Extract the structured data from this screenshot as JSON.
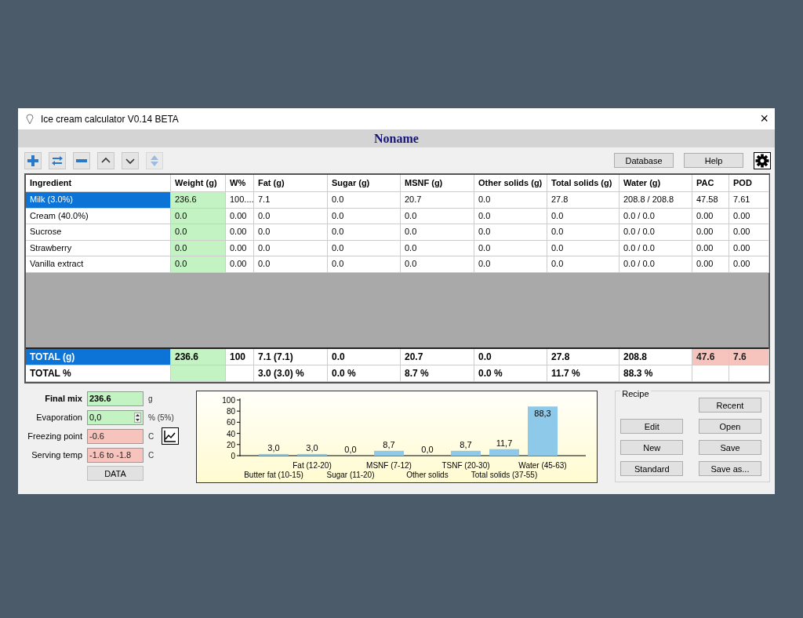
{
  "window": {
    "title": "Ice cream calculator  V0.14 BETA",
    "close": "×"
  },
  "recipe_name": "Noname",
  "toolbar": {
    "tools": [
      {
        "kind": "plus",
        "disabled": false
      },
      {
        "kind": "swap",
        "disabled": false
      },
      {
        "kind": "minus",
        "disabled": false
      },
      {
        "kind": "up",
        "disabled": false
      },
      {
        "kind": "down",
        "disabled": false
      },
      {
        "kind": "updown",
        "disabled": true
      }
    ],
    "buttons": [
      "Database",
      "Help"
    ]
  },
  "table": {
    "columns": [
      "Ingredient",
      "Weight (g)",
      "W%",
      "Fat (g)",
      "Sugar (g)",
      "MSNF (g)",
      "Other solids (g)",
      "Total solids (g)",
      "Water (g)",
      "PAC",
      "POD"
    ],
    "rows": [
      {
        "selected": true,
        "cells": [
          "Milk (3.0%)",
          "236.6",
          "100....",
          "7.1",
          "0.0",
          "20.7",
          "0.0",
          "27.8",
          "208.8 / 208.8",
          "47.58",
          "7.61"
        ]
      },
      {
        "selected": false,
        "cells": [
          "Cream (40.0%)",
          "0.0",
          "0.00",
          "0.0",
          "0.0",
          "0.0",
          "0.0",
          "0.0",
          "0.0 / 0.0",
          "0.00",
          "0.00"
        ]
      },
      {
        "selected": false,
        "cells": [
          "Sucrose",
          "0.0",
          "0.00",
          "0.0",
          "0.0",
          "0.0",
          "0.0",
          "0.0",
          "0.0 / 0.0",
          "0.00",
          "0.00"
        ]
      },
      {
        "selected": false,
        "cells": [
          "Strawberry",
          "0.0",
          "0.00",
          "0.0",
          "0.0",
          "0.0",
          "0.0",
          "0.0",
          "0.0 / 0.0",
          "0.00",
          "0.00"
        ]
      },
      {
        "selected": false,
        "cells": [
          "Vanilla extract",
          "0.0",
          "0.00",
          "0.0",
          "0.0",
          "0.0",
          "0.0",
          "0.0",
          "0.0 / 0.0",
          "0.00",
          "0.00"
        ]
      }
    ],
    "totals": [
      {
        "selected": true,
        "cells": [
          "TOTAL (g)",
          "236.6",
          "100",
          "7.1 (7.1)",
          "0.0",
          "20.7",
          "0.0",
          "27.8",
          "208.8",
          "47.6",
          "7.6"
        ],
        "pac_warn": true,
        "pod_warn": true
      },
      {
        "selected": false,
        "cells": [
          "TOTAL %",
          null,
          null,
          "3.0 (3.0) %",
          "0.0 %",
          "8.7 %",
          "0.0 %",
          "11.7 %",
          "88.3 %",
          null,
          null
        ],
        "pac_warn": false,
        "pod_warn": false
      }
    ]
  },
  "mix": {
    "fields": [
      {
        "label": "Final mix",
        "value": "236.6",
        "unit": "g",
        "warn": false,
        "kind": "bold"
      },
      {
        "label": "Evaporation",
        "value": "0,0",
        "unit": "% (5%)",
        "warn": false,
        "kind": "spin"
      },
      {
        "label": "Freezing point",
        "value": "-0.6",
        "unit": "C",
        "warn": true,
        "kind": "graph"
      },
      {
        "label": "Serving temp",
        "value": "-1.6 to -1.8",
        "unit": "C",
        "warn": true,
        "kind": "plain"
      }
    ],
    "data_button": "DATA"
  },
  "chart_data": {
    "type": "bar",
    "categories": [
      "Butter fat (10-15)",
      "Fat (12-20)",
      "Sugar (11-20)",
      "MSNF (7-12)",
      "Other solids",
      "TSNF (20-30)",
      "Total solids (37-55)",
      "Water (45-63)"
    ],
    "series": [
      {
        "color": "#8ec9ea",
        "values": [
          3.0,
          3.0,
          0.0,
          8.7,
          0.0,
          8.7,
          11.7,
          88.3
        ]
      }
    ],
    "ylim": [
      0,
      100
    ],
    "yticks": [
      0,
      20,
      40,
      60,
      80,
      100
    ],
    "value_labels": [
      "3,0",
      "3,0",
      "0,0",
      "8,7",
      "0,0",
      "8,7",
      "11,7",
      "88,3"
    ]
  },
  "recipe": {
    "title": "Recipe",
    "buttons": [
      "Recent",
      "Edit",
      "Open",
      "New",
      "Save",
      "Standard",
      "Save as..."
    ]
  }
}
